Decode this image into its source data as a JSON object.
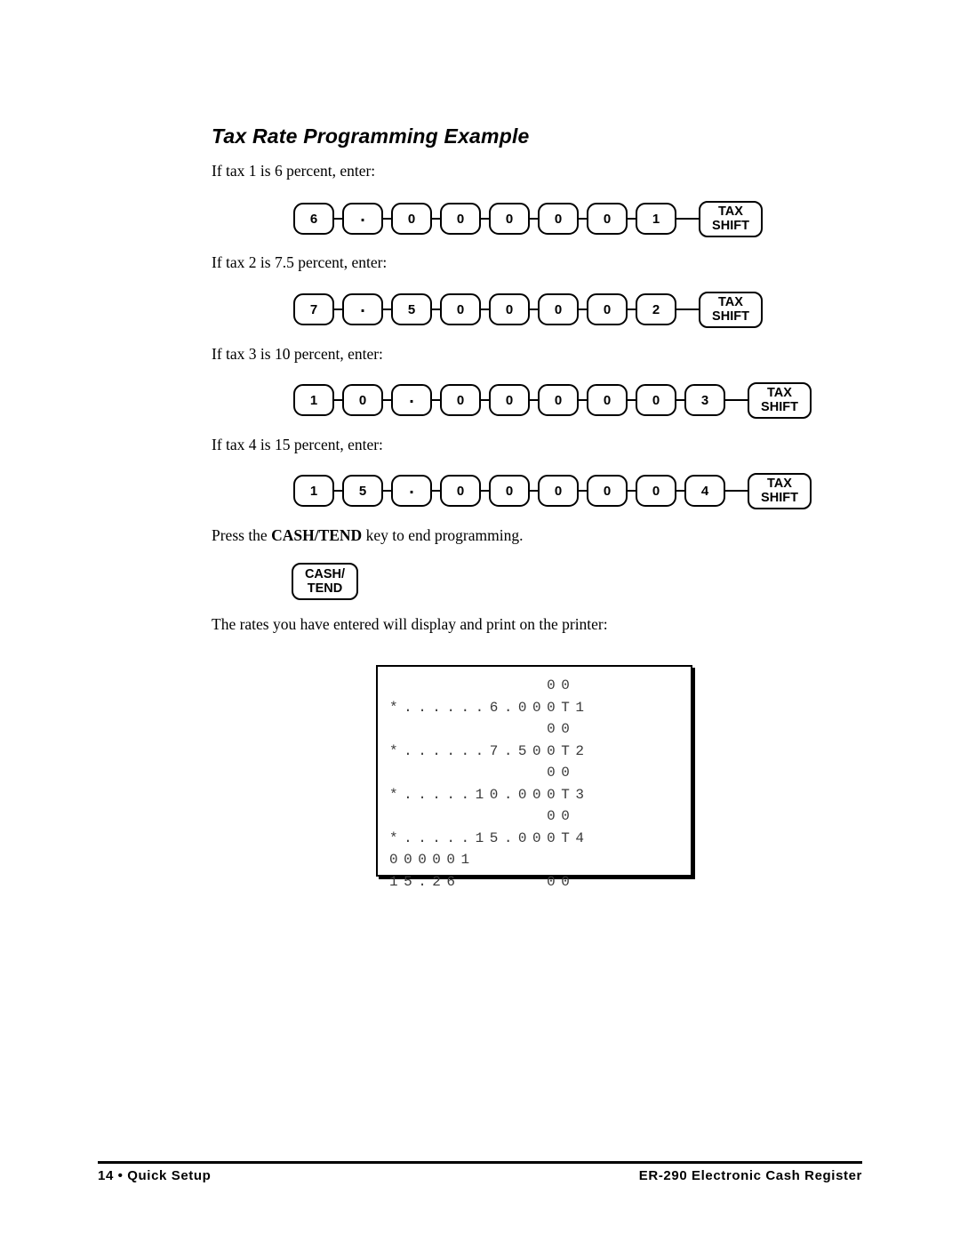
{
  "document": {
    "section_title": "Tax Rate Programming Example"
  },
  "steps": [
    {
      "text": "If tax 1 is 6 percent, enter:",
      "keys": [
        "6",
        ".",
        "0",
        "0",
        "0",
        "0",
        "0",
        "1"
      ],
      "final_key": {
        "line1": "TAX",
        "line2": "SHIFT"
      }
    },
    {
      "text": "If tax 2 is 7.5 percent, enter:",
      "keys": [
        "7",
        ".",
        "5",
        "0",
        "0",
        "0",
        "0",
        "2"
      ],
      "final_key": {
        "line1": "TAX",
        "line2": "SHIFT"
      }
    },
    {
      "text": "If tax 3 is 10 percent, enter:",
      "keys": [
        "1",
        "0",
        ".",
        "0",
        "0",
        "0",
        "0",
        "0",
        "3"
      ],
      "final_key": {
        "line1": "TAX",
        "line2": "SHIFT"
      }
    },
    {
      "text": "If tax 4 is 15 percent, enter:",
      "keys": [
        "1",
        "5",
        ".",
        "0",
        "0",
        "0",
        "0",
        "0",
        "4"
      ],
      "final_key": {
        "line1": "TAX",
        "line2": "SHIFT"
      }
    }
  ],
  "end_instruction": {
    "prefix": "Press the ",
    "bold": "CASH/TEND",
    "suffix": " key to end programming.",
    "key": {
      "line1": "CASH/",
      "line2": "TEND"
    }
  },
  "printer_note": "The rates you have entered will display and print on the printer:",
  "receipt": {
    "lines": [
      "           00",
      "*......6.000T1",
      "           00",
      "*......7.500T2",
      "           00",
      "*.....10.000T3",
      "           00",
      "*.....15.000T4",
      "000001",
      "15.26      00"
    ]
  },
  "footer": {
    "left": "14 • Quick Setup",
    "right": "ER-290 Electronic Cash Register"
  }
}
